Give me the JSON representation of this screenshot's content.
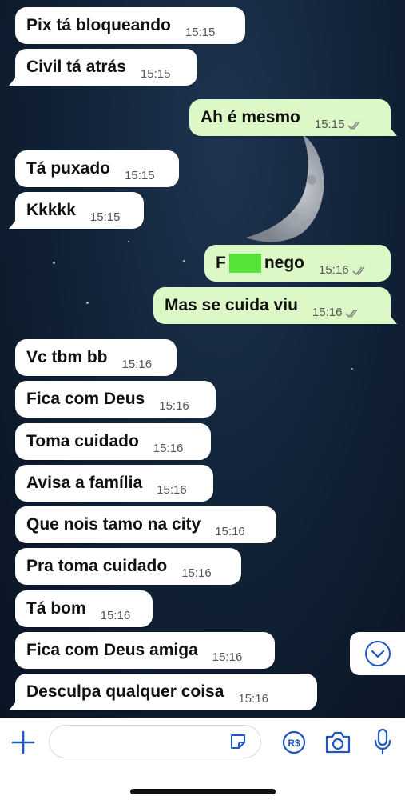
{
  "messages": [
    {
      "text": "Pix tá bloqueando",
      "time": "15:15",
      "dir": "in"
    },
    {
      "text": "Civil tá atrás",
      "time": "15:15",
      "dir": "in"
    },
    {
      "text": "Ah é mesmo",
      "time": "15:15",
      "dir": "out"
    },
    {
      "text": "Tá puxado",
      "time": "15:15",
      "dir": "in"
    },
    {
      "text": "Kkkkk",
      "time": "15:15",
      "dir": "in"
    },
    {
      "text_before": "F",
      "text_after": "nego",
      "time": "15:16",
      "dir": "out"
    },
    {
      "text": "Mas se cuida viu",
      "time": "15:16",
      "dir": "out"
    },
    {
      "text": "Vc tbm bb",
      "time": "15:16",
      "dir": "in"
    },
    {
      "text": "Fica com Deus",
      "time": "15:16",
      "dir": "in"
    },
    {
      "text": "Toma cuidado",
      "time": "15:16",
      "dir": "in"
    },
    {
      "text": "Avisa a família",
      "time": "15:16",
      "dir": "in"
    },
    {
      "text": "Que nois tamo na city",
      "time": "15:16",
      "dir": "in"
    },
    {
      "text": "Pra toma cuidado",
      "time": "15:16",
      "dir": "in"
    },
    {
      "text": "Tá bom",
      "time": "15:16",
      "dir": "in"
    },
    {
      "text": "Fica com Deus amiga",
      "time": "15:16",
      "dir": "in"
    },
    {
      "text": "Desculpa qualquer coisa",
      "time": "15:16",
      "dir": "in"
    }
  ],
  "composer": {
    "placeholder": "",
    "icons": [
      "plus-icon",
      "sticker-icon",
      "pix-payment-icon",
      "camera-icon",
      "microphone-icon"
    ],
    "accent": "#1f57c4"
  },
  "colors": {
    "incoming_bubble": "#ffffff",
    "outgoing_bubble": "#dcf8c6",
    "censor_block": "#55e33a"
  }
}
